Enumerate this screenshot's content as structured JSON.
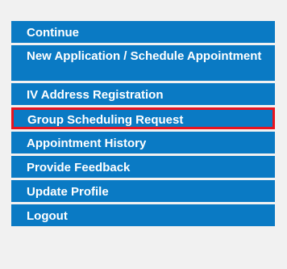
{
  "menu": {
    "items": [
      {
        "label": "Continue",
        "highlighted": false
      },
      {
        "label": "New Application / Schedule Appointment",
        "highlighted": false
      },
      {
        "label": "IV Address Registration",
        "highlighted": false
      },
      {
        "label": "Group Scheduling Request",
        "highlighted": true
      },
      {
        "label": "Appointment History",
        "highlighted": false
      },
      {
        "label": "Provide Feedback",
        "highlighted": false
      },
      {
        "label": "Update Profile",
        "highlighted": false
      },
      {
        "label": "Logout",
        "highlighted": false
      }
    ]
  },
  "colors": {
    "item_background": "#0a7ac4",
    "item_text": "#ffffff",
    "highlight_border": "#e8141f",
    "page_background": "#f1f1f1"
  }
}
